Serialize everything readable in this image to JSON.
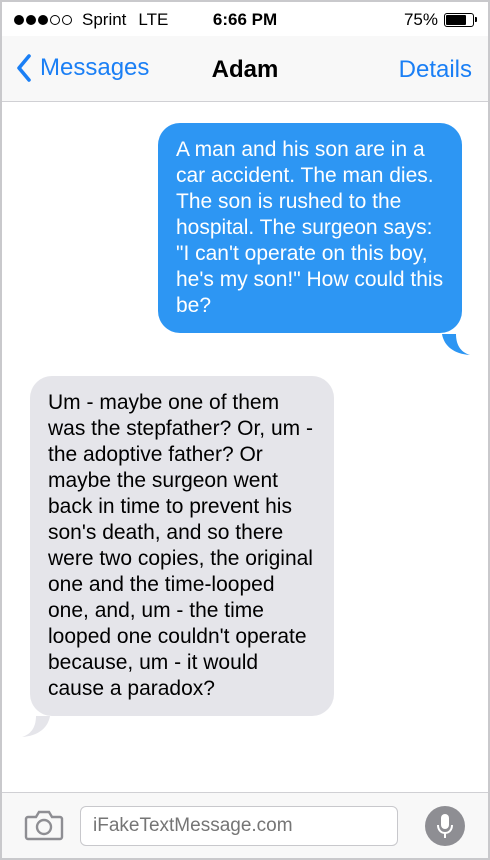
{
  "status_bar": {
    "carrier": "Sprint",
    "network": "LTE",
    "time": "6:66 PM",
    "battery_text": "75%",
    "battery_level": 0.75,
    "signal_bars_filled": 3,
    "signal_bars_total": 5
  },
  "nav": {
    "back_label": "Messages",
    "title": "Adam",
    "details_label": "Details"
  },
  "messages": [
    {
      "direction": "sent",
      "text": "A man and his son are in a car accident. The man dies. The son is rushed to the hospital. The surgeon says: \"I can't operate on this boy, he's my son!\" How could this be?"
    },
    {
      "direction": "received",
      "text": "Um - maybe one of them was the stepfather? Or, um - the adoptive father? Or maybe the surgeon went back in time to prevent his son's death, and so there were two copies, the original one and the time-looped one, and, um - the time looped one couldn't operate because, um - it would cause a paradox?"
    }
  ],
  "composer": {
    "placeholder": "iFakeTextMessage.com"
  },
  "colors": {
    "accent": "#1a7ff5",
    "sent_bubble": "#2d96f3",
    "received_bubble": "#e5e5ea",
    "mic_button": "#8e8e93"
  },
  "icons": {
    "back": "chevron-left-icon",
    "camera": "camera-icon",
    "mic": "microphone-icon",
    "battery": "battery-icon",
    "signal": "signal-dots-icon"
  }
}
